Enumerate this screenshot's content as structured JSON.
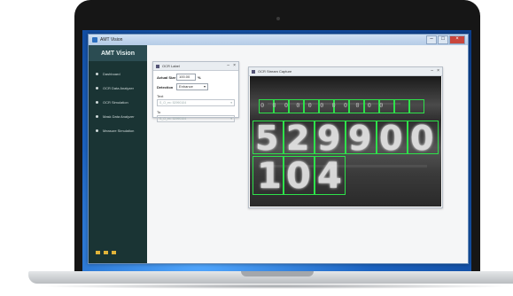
{
  "app": {
    "window_title": "AMT Vision",
    "brand": "AMT Vision"
  },
  "sidebar": {
    "items": [
      {
        "label": "Dashboard"
      },
      {
        "label": "OCR Data Analyzer"
      },
      {
        "label": "OCR Simulation"
      },
      {
        "label": "Mask Data Analyzer"
      },
      {
        "label": "Measure Simulation"
      }
    ]
  },
  "ocr_label_panel": {
    "title": "OCR Label",
    "actual_size_label": "Actual Size",
    "actual_size_value": "100.00",
    "actual_size_unit": "%",
    "detection_label": "Detection",
    "detection_value": "Enhance",
    "text_label": "Text",
    "text_placeholder": "S_O_ex: 52990104",
    "to_label": "To",
    "to_placeholder": "S_O_ex: 52990104"
  },
  "ocr_stream_panel": {
    "title": "OCR Stream Capture",
    "top_char_row": "00000000000",
    "large_digits": [
      "5",
      "2",
      "9",
      "9",
      "0",
      "0"
    ],
    "second_row_digits": [
      "1",
      "0",
      "4"
    ]
  },
  "colors": {
    "sidebar_bg": "#1a3434",
    "box_green": "#2ee24a",
    "desktop_blue": "#1f6fc4"
  }
}
